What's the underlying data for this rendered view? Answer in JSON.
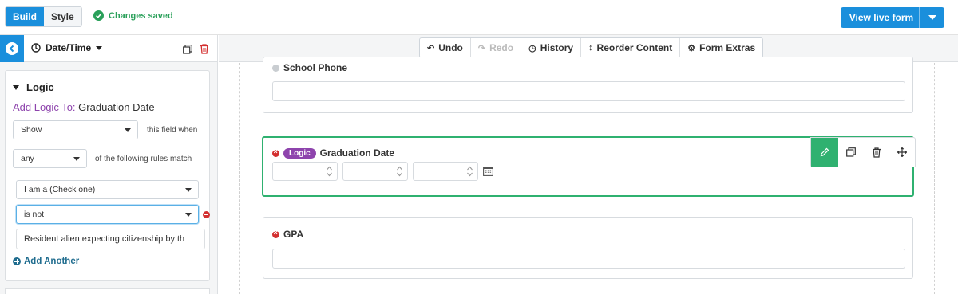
{
  "topbar": {
    "tab_build": "Build",
    "tab_style": "Style",
    "status": "Changes saved",
    "live_button": "View live form"
  },
  "left_panel": {
    "field_type": "Date/Time",
    "logic": {
      "title": "Logic",
      "add_logic_prefix": "Add Logic To:",
      "field_name": "Graduation Date",
      "action_value": "Show",
      "action_suffix": "this field when",
      "match_value": "any",
      "match_suffix": "of the following rules match",
      "rule_field": "I am a (Check one)",
      "rule_operator": "is not",
      "rule_value": "Resident alien expecting citizenship by th",
      "add_another": "Add Another"
    }
  },
  "toolbar": {
    "undo": "Undo",
    "redo": "Redo",
    "history": "History",
    "reorder": "Reorder Content",
    "extras": "Form Extras"
  },
  "form": {
    "fields": [
      {
        "label": "School Phone",
        "required": false
      },
      {
        "label": "Graduation Date",
        "required": true,
        "badge": "Logic"
      },
      {
        "label": "GPA",
        "required": true
      }
    ]
  },
  "colors": {
    "primary": "#1a8fdc",
    "success": "#2fb170",
    "logic_purple": "#8e44ad",
    "danger": "#d32f2f",
    "link_teal": "#1f6c8e"
  }
}
